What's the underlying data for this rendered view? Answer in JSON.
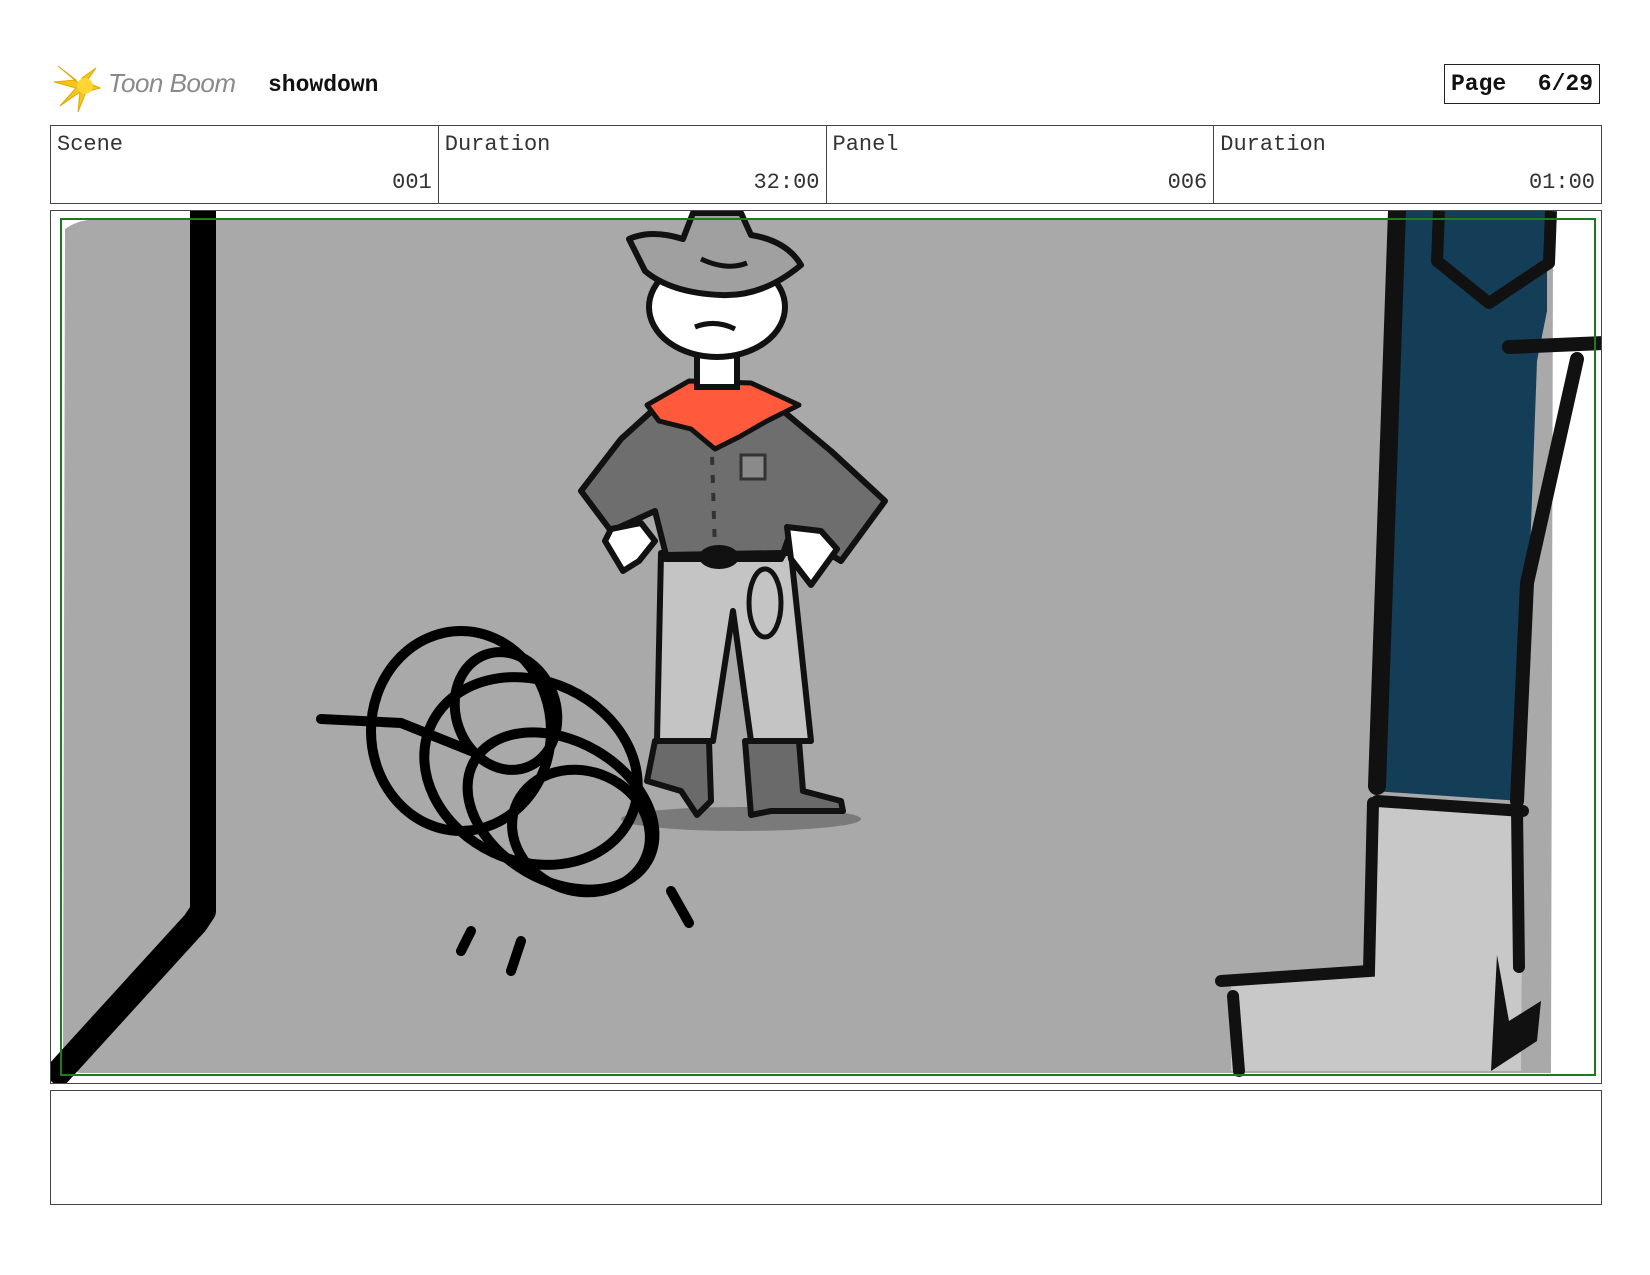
{
  "header": {
    "logo_text": "Toon Boom",
    "project_title": "showdown",
    "page_label": "Page",
    "page_value": "6/29"
  },
  "info": {
    "scene_label": "Scene",
    "scene_value": "001",
    "scene_duration_label": "Duration",
    "scene_duration_value": "32:00",
    "panel_label": "Panel",
    "panel_value": "006",
    "panel_duration_label": "Duration",
    "panel_duration_value": "01:00"
  },
  "colors": {
    "background_gray": "#a9a9a9",
    "bandana": "#ff5a3c",
    "door": "#143e58",
    "safe_area": "#1e7a1e"
  },
  "notes": {
    "text": ""
  }
}
